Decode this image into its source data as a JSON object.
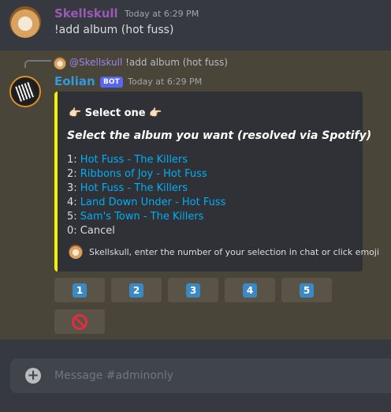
{
  "message_user": {
    "author": "Skellskull",
    "timestamp": "Today at 6:29 PM",
    "content": "!add album (hot fuss)",
    "author_color": "#9b59b6"
  },
  "message_bot": {
    "reply": {
      "mention": "@Skellskull",
      "content": "!add album (hot fuss)"
    },
    "author": "Eolian",
    "badge": "BOT",
    "timestamp": "Today at 6:29 PM",
    "author_color": "#3498db",
    "embed": {
      "accent_color": "#f2f200",
      "author_line": "👉🏻 Select one 👉🏻",
      "title": "Select the album you want (resolved via Spotify)",
      "options": [
        {
          "num": "1:",
          "label": "Hot Fuss - The Killers"
        },
        {
          "num": "2:",
          "label": "Ribbons of Joy - Hot Fuss"
        },
        {
          "num": "3:",
          "label": "Hot Fuss - The Killers"
        },
        {
          "num": "4:",
          "label": "Land Down Under - Hot Fuss"
        },
        {
          "num": "5:",
          "label": "Sam's Town - The Killers"
        },
        {
          "num": "0:",
          "label": "Cancel"
        }
      ],
      "footer": "Skellskull, enter the number of your selection in chat or click emoji"
    },
    "buttons": [
      {
        "label": "1",
        "icon": "keycap-1-icon"
      },
      {
        "label": "2",
        "icon": "keycap-2-icon"
      },
      {
        "label": "3",
        "icon": "keycap-3-icon"
      },
      {
        "label": "4",
        "icon": "keycap-4-icon"
      },
      {
        "label": "5",
        "icon": "keycap-5-icon"
      },
      {
        "label": "",
        "icon": "no-entry-icon"
      }
    ]
  },
  "composer": {
    "placeholder": "Message #adminonly"
  }
}
